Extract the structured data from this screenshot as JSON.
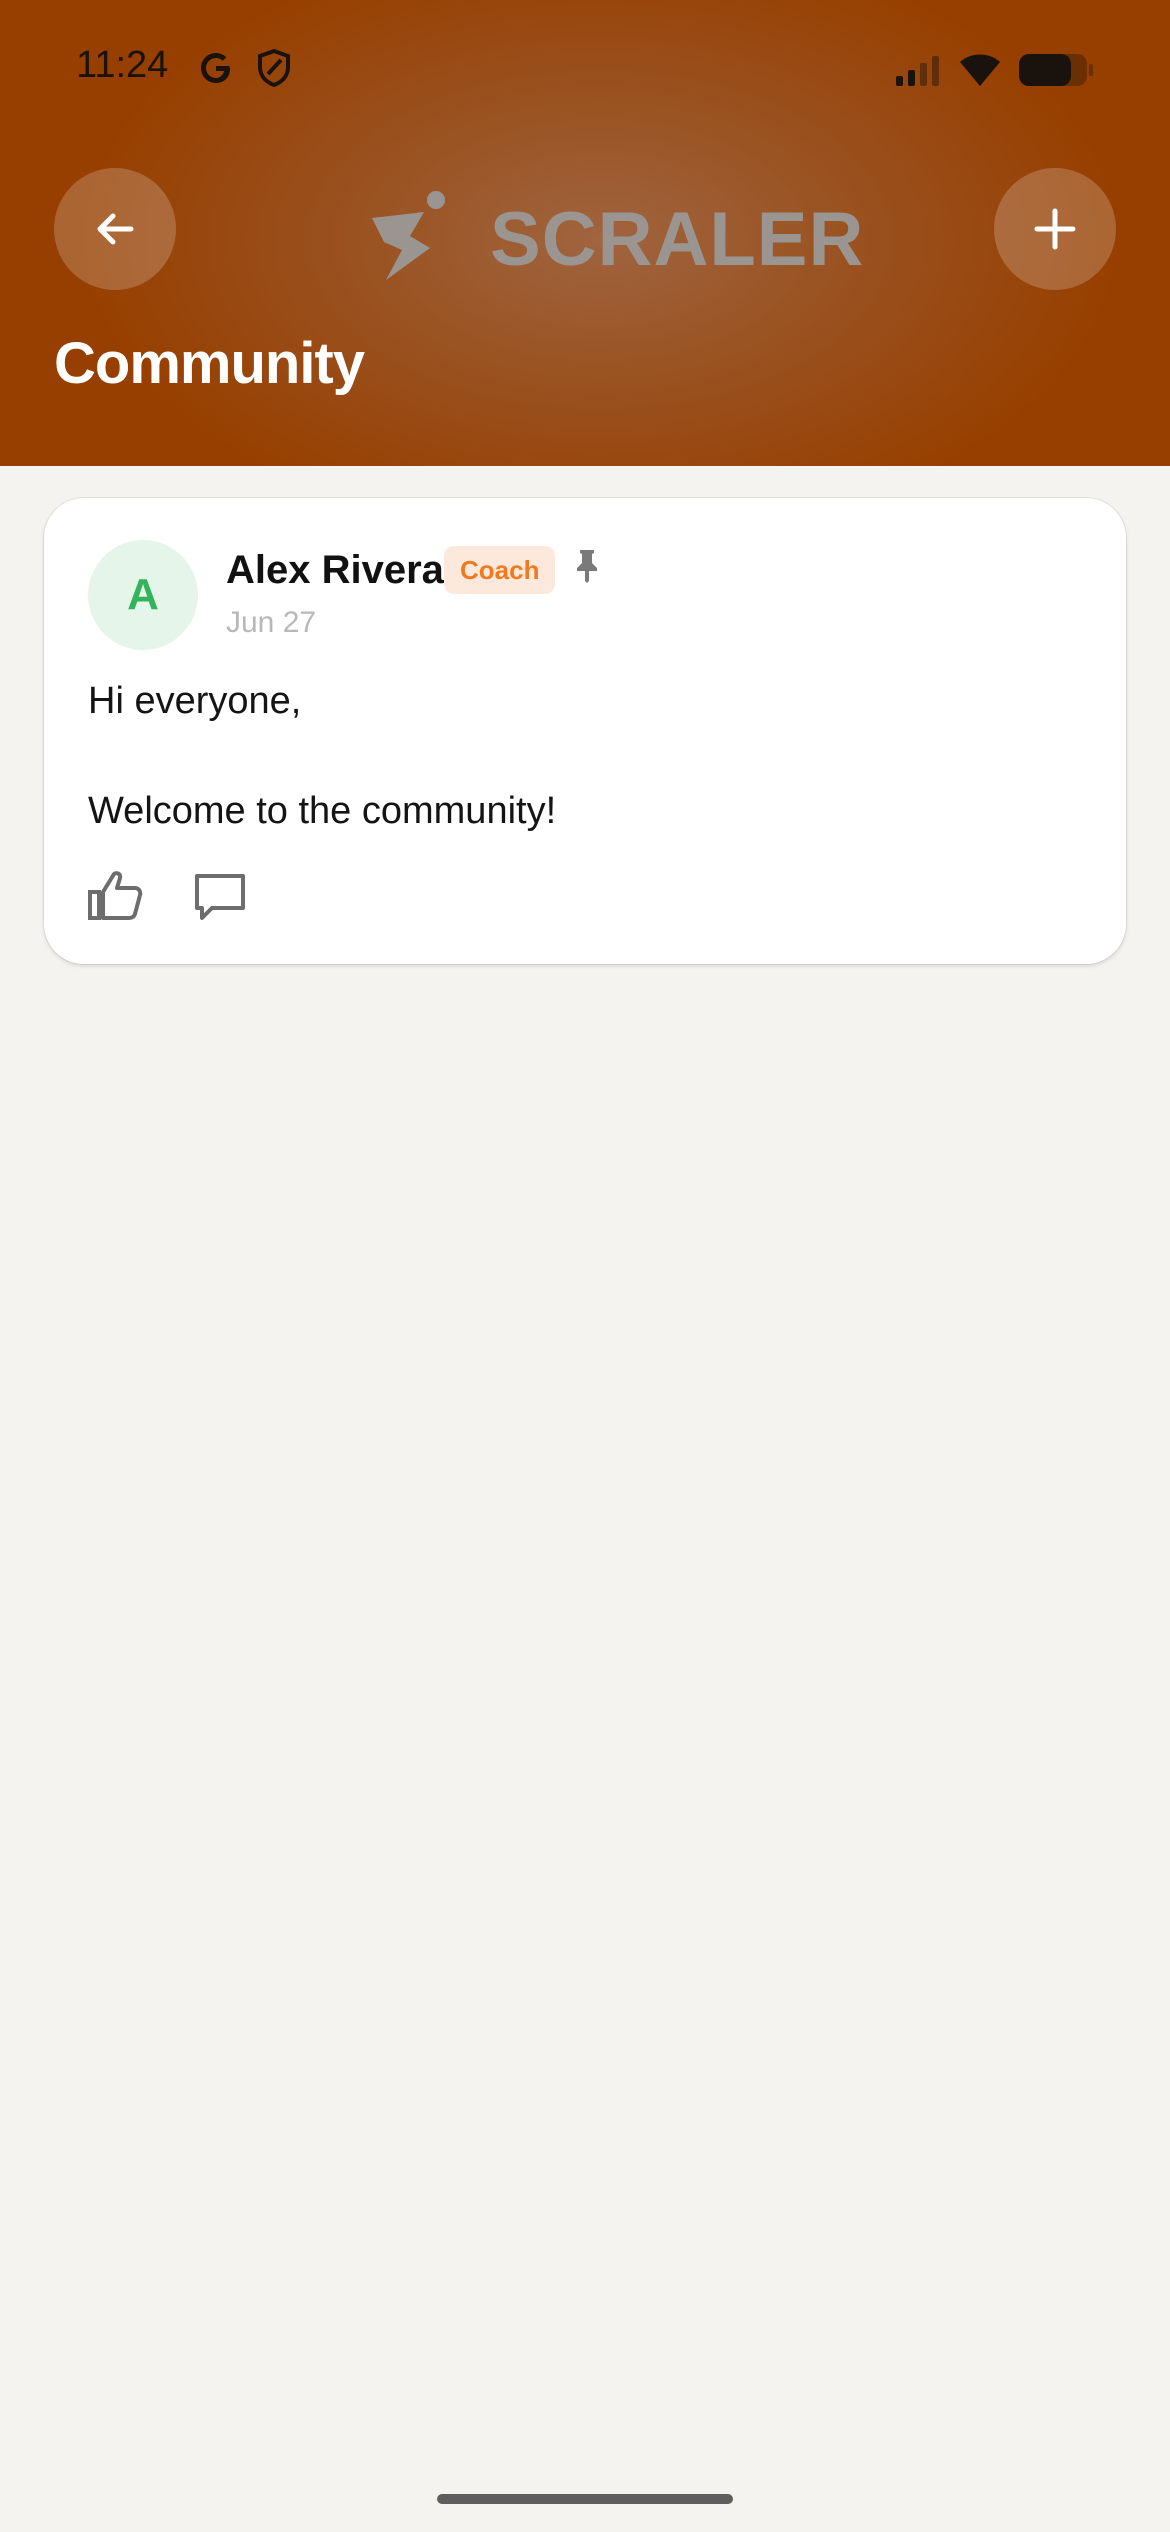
{
  "status_bar": {
    "time": "11:24"
  },
  "header": {
    "logo_text": "SCRALER",
    "title": "Community"
  },
  "post": {
    "avatar_letter": "A",
    "author": "Alex Rivera",
    "role": "Coach",
    "date": "Jun 27",
    "body": "Hi everyone,\n\nWelcome to the community!"
  },
  "colors": {
    "header_bg": "#973f00",
    "badge_text": "#f07a1f",
    "badge_bg": "#fde9dc",
    "avatar_bg": "#e5f5ea",
    "avatar_text": "#33b35c",
    "page_bg": "#f4f3f0"
  },
  "icons": [
    "google-icon",
    "shield-icon",
    "signal-icon",
    "wifi-icon",
    "battery-icon",
    "back-arrow-icon",
    "plus-icon",
    "pin-icon",
    "thumbs-up-icon",
    "comment-icon"
  ]
}
